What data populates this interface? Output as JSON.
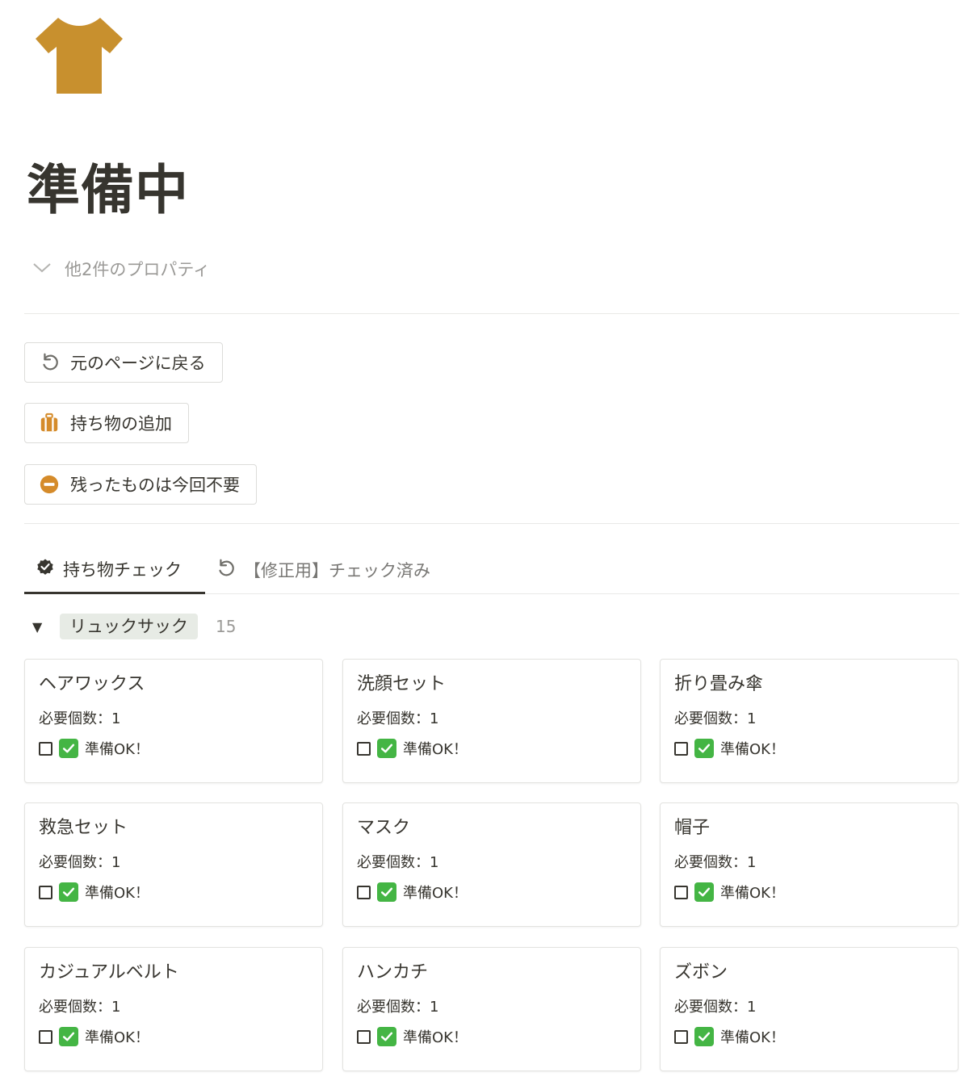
{
  "page": {
    "title": "準備中",
    "icon": "tshirt-icon",
    "icon_color": "#c8902e",
    "properties_toggle": "他2件のプロパティ"
  },
  "buttons": [
    {
      "label": "元のページに戻る",
      "icon": "undo-icon"
    },
    {
      "label": "持ち物の追加",
      "icon": "luggage-icon"
    },
    {
      "label": "残ったものは今回不要",
      "icon": "minus-circle-icon"
    }
  ],
  "tabs": [
    {
      "label": "持ち物チェック",
      "icon": "verified-badge-icon",
      "active": true
    },
    {
      "label": "【修正用】チェック済み",
      "icon": "undo-icon",
      "active": false
    }
  ],
  "group": {
    "label": "リュックサック",
    "count": "15",
    "label_bg": "#e7ebe5"
  },
  "cards": [
    {
      "title": "ヘアワックス",
      "qty": "必要個数：1",
      "check_label": "準備OK！"
    },
    {
      "title": "洗顔セット",
      "qty": "必要個数：1",
      "check_label": "準備OK！"
    },
    {
      "title": "折り畳み傘",
      "qty": "必要個数：1",
      "check_label": "準備OK！"
    },
    {
      "title": "救急セット",
      "qty": "必要個数：1",
      "check_label": "準備OK！"
    },
    {
      "title": "マスク",
      "qty": "必要個数：1",
      "check_label": "準備OK！"
    },
    {
      "title": "帽子",
      "qty": "必要個数：1",
      "check_label": "準備OK！"
    },
    {
      "title": "カジュアルベルト",
      "qty": "必要個数：1",
      "check_label": "準備OK！"
    },
    {
      "title": "ハンカチ",
      "qty": "必要個数：1",
      "check_label": "準備OK！"
    },
    {
      "title": "ズボン",
      "qty": "必要個数：1",
      "check_label": "準備OK！"
    }
  ],
  "colors": {
    "accent_orange": "#d58b2a",
    "check_green": "#44b544",
    "text": "#37352f",
    "muted": "#9b9a97"
  }
}
